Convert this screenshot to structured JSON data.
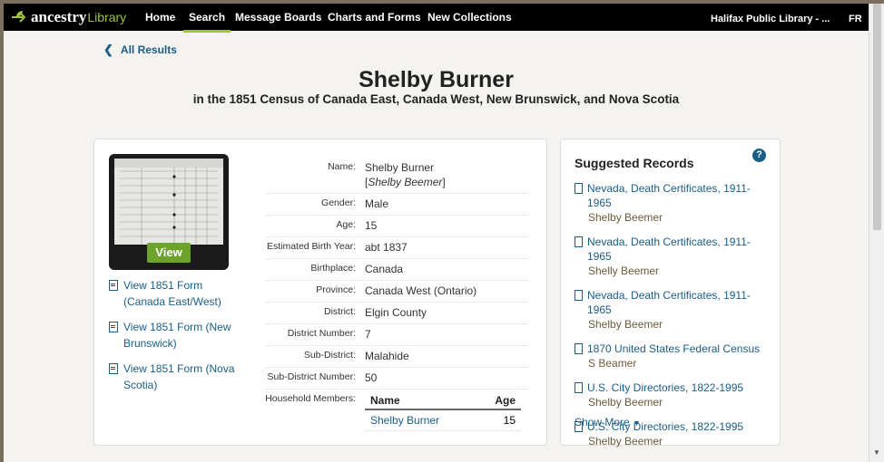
{
  "nav": {
    "logo_text": "ancestry",
    "logo_lib": "Library",
    "items": [
      "Home",
      "Search",
      "Message Boards",
      "Charts and Forms",
      "New Collections"
    ],
    "active": "Search",
    "library": "Halifax Public Library - ...",
    "lang": "FR"
  },
  "back_label": "All Results",
  "title": "Shelby Burner",
  "subtitle": "in the 1851 Census of Canada East, Canada West, New Brunswick, and Nova Scotia",
  "view_label": "View",
  "form_links": [
    "View 1851 Form (Canada East/West)",
    "View 1851 Form (New Brunswick)",
    "View 1851 Form (Nova Scotia)"
  ],
  "fields": {
    "name_label": "Name:",
    "name_value": "Shelby Burner",
    "name_alt": "Shelby Beemer",
    "gender_label": "Gender:",
    "gender_value": "Male",
    "age_label": "Age:",
    "age_value": "15",
    "birth_year_label": "Estimated Birth Year:",
    "birth_year_value": "abt 1837",
    "birthplace_label": "Birthplace:",
    "birthplace_value": "Canada",
    "province_label": "Province:",
    "province_value": "Canada West (Ontario)",
    "district_label": "District:",
    "district_value": "Elgin County",
    "district_number_label": "District Number:",
    "district_number_value": "7",
    "sub_district_label": "Sub-District:",
    "sub_district_value": "Malahide",
    "sub_district_number_label": "Sub-District Number:",
    "sub_district_number_value": "50",
    "household_label": "Household Members:"
  },
  "household": {
    "col_name": "Name",
    "col_age": "Age",
    "members": [
      {
        "name": "Shelby Burner",
        "age": "15"
      }
    ]
  },
  "suggested": {
    "title": "Suggested Records",
    "help": "?",
    "items": [
      {
        "collection": "Nevada, Death Certificates, 1911-1965",
        "name": "Shelby Beemer"
      },
      {
        "collection": "Nevada, Death Certificates, 1911-1965",
        "name": "Shelly Beemer"
      },
      {
        "collection": "Nevada, Death Certificates, 1911-1965",
        "name": "Shelby Beemer"
      },
      {
        "collection": "1870 United States Federal Census",
        "name": "S Beamer"
      },
      {
        "collection": "U.S. City Directories, 1822-1995",
        "name": "Shelby Beemer"
      },
      {
        "collection": "U.S. City Directories, 1822-1995",
        "name": "Shelby Beemer"
      }
    ],
    "show_more": "Show More"
  },
  "colors": {
    "nav_bg": "#000000",
    "accent_green": "#9ec33c",
    "link_blue": "#1a5d86",
    "view_button": "#6da22b"
  }
}
